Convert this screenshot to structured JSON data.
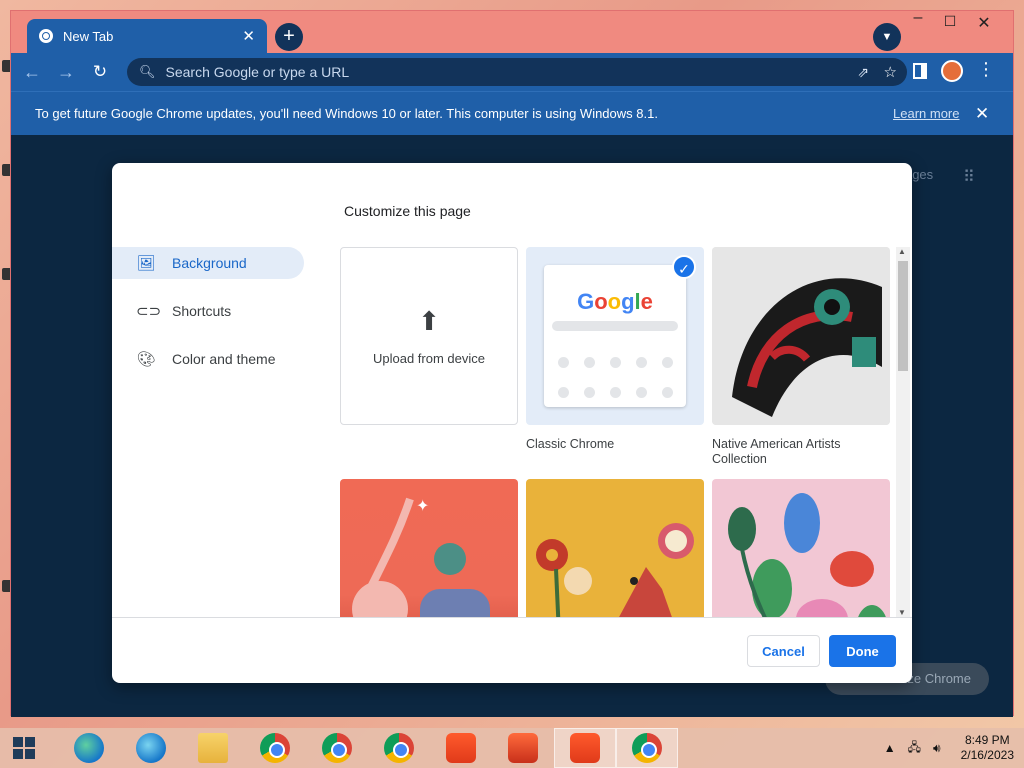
{
  "browser": {
    "tab_title": "New Tab",
    "omnibox_placeholder": "Search Google or type a URL"
  },
  "infobar": {
    "message": "To get future Google Chrome updates, you'll need Windows 10 or later. This computer is using Windows 8.1.",
    "link": "Learn more"
  },
  "ntp": {
    "images_link": "Google Images",
    "customize_button": "Customize Chrome"
  },
  "dialog": {
    "title": "Customize this page",
    "menu": [
      {
        "label": "Background",
        "icon": "image-icon",
        "active": true
      },
      {
        "label": "Shortcuts",
        "icon": "link-icon",
        "active": false
      },
      {
        "label": "Color and theme",
        "icon": "palette-icon",
        "active": false
      }
    ],
    "tiles": [
      {
        "caption": "Upload from device"
      },
      {
        "caption": "Classic Chrome",
        "selected": true
      },
      {
        "caption": "Native American Artists Collection"
      }
    ],
    "google_logo": {
      "l1": "G",
      "l2": "o",
      "l3": "o",
      "l4": "g",
      "l5": "l",
      "l6": "e"
    },
    "cancel": "Cancel",
    "done": "Done"
  },
  "taskbar": {
    "time": "8:49 PM",
    "date": "2/16/2023"
  },
  "colors": {
    "accent": "#1a73e8",
    "toolbar": "#1f5fa8",
    "ntp_background": "#0c2741",
    "titlebar": "#f08a80"
  }
}
